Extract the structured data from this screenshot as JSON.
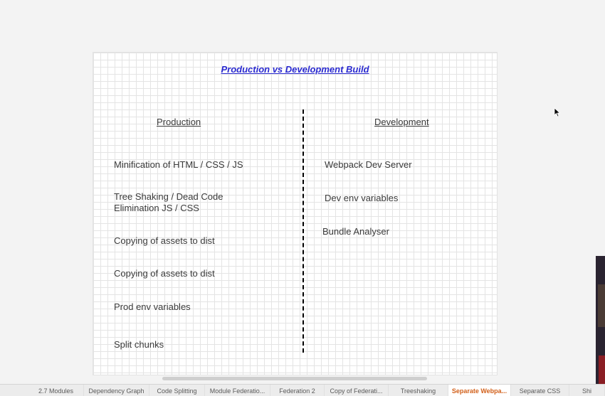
{
  "diagram": {
    "title": "Production vs Development Build",
    "production": {
      "header": "Production",
      "items": [
        "Minification of HTML / CSS / JS",
        "Tree Shaking / Dead Code\nElimination JS / CSS",
        "Copying of assets to dist",
        "Copying of assets to dist",
        "Prod env variables",
        "Split chunks"
      ]
    },
    "development": {
      "header": "Development",
      "items": [
        "Webpack Dev Server",
        "Dev env variables",
        "Bundle Analyser"
      ]
    }
  },
  "tabs": [
    {
      "label": "2.7 Modules",
      "active": false
    },
    {
      "label": "Dependency Graph",
      "active": false
    },
    {
      "label": "Code Splitting",
      "active": false
    },
    {
      "label": "Module Federatio...",
      "active": false
    },
    {
      "label": "Federation 2",
      "active": false
    },
    {
      "label": "Copy of Federati...",
      "active": false
    },
    {
      "label": "Treeshaking",
      "active": false
    },
    {
      "label": "Separate Webpa...",
      "active": true
    },
    {
      "label": "Separate CSS",
      "active": false
    },
    {
      "label": "Shi",
      "active": false
    }
  ],
  "colors": {
    "title": "#2a2ad0",
    "active_tab": "#d2601a",
    "text": "#3a3a3a"
  },
  "icons": [
    "mouse-cursor-icon"
  ]
}
